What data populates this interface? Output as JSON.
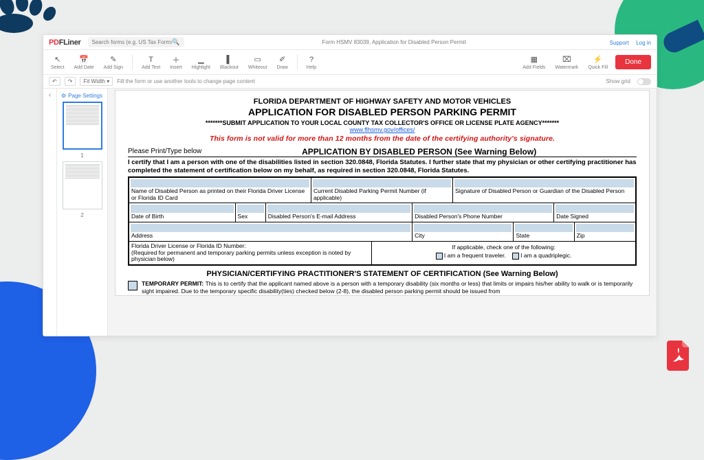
{
  "brand": {
    "pre": "P",
    "mid": "D",
    "post": "FLiner"
  },
  "search_placeholder": "Search forms (e.g. US Tax Forms...",
  "doc_title": "Form HSMV 83039, Application for Disabled Person Permit",
  "links": {
    "support": "Support",
    "login": "Log in"
  },
  "toolbar": [
    {
      "icon": "↖",
      "label": "Select"
    },
    {
      "icon": "📅",
      "label": "Add Date"
    },
    {
      "icon": "✎",
      "label": "Add Sign"
    },
    {
      "sep": true
    },
    {
      "icon": "T",
      "label": "Add Text"
    },
    {
      "icon": "＋",
      "label": "Insert"
    },
    {
      "icon": "▁",
      "label": "Highlight"
    },
    {
      "icon": "▌",
      "label": "Blackout"
    },
    {
      "icon": "▭",
      "label": "Whiteout"
    },
    {
      "icon": "✐",
      "label": "Draw"
    },
    {
      "sep": true
    },
    {
      "icon": "?",
      "label": "Help"
    }
  ],
  "toolbar_right": [
    {
      "icon": "▦",
      "label": "Add Fields"
    },
    {
      "icon": "⌧",
      "label": "Watermark"
    },
    {
      "icon": "⚡",
      "label": "Quick Fill"
    }
  ],
  "done_label": "Done",
  "subbar": {
    "fit": "Fit Width",
    "hint": "Fill the form or use another tools to change page content",
    "showgrid": "Show grid"
  },
  "thumbs_header": "Page Settings",
  "thumb_nums": [
    "1",
    "2"
  ],
  "page": {
    "dept": "FLORIDA DEPARTMENT OF HIGHWAY SAFETY AND MOTOR VEHICLES",
    "app_title": "APPLICATION FOR DISABLED PERSON PARKING PERMIT",
    "submit": "*******SUBMIT APPLICATION TO YOUR LOCAL COUNTY TAX COLLECTOR'S OFFICE OR LICENSE PLATE AGENCY*******",
    "url": "www.flhsmv.gov/offices/",
    "red": "This form is not valid for more than 12 months from the date of the certifying authority's signature.",
    "please": "Please Print/Type below",
    "section1": "APPLICATION BY DISABLED PERSON (See Warning Below)",
    "cert": "I certify that I am a person with one of the disabilities listed in section 320.0848, Florida Statutes.  I further state that my physician or other certifying practitioner has completed the statement of certification below on my behalf, as required in section 320.0848, Florida Statutes.",
    "fields": {
      "name": "Name of Disabled Person as printed on their Florida Driver License or Florida ID Card",
      "permitno": "Current Disabled Parking Permit Number (if applicable)",
      "sig": "Signature of Disabled Person or Guardian of the Disabled Person",
      "dob": "Date of Birth",
      "sex": "Sex",
      "email": "Disabled Person's E-mail Address",
      "phone": "Disabled Person's Phone Number",
      "datesigned": "Date Signed",
      "address": "Address",
      "city": "City",
      "state": "State",
      "zip": "Zip",
      "flid": "Florida Driver License or Florida ID Number:\n(Required for permanent and temporary parking permits unless exception is noted by physician below)",
      "checkhead": "If applicable, check one of the following:",
      "opt1": "I am a frequent traveler.",
      "opt2": "I am a quadriplegic."
    },
    "phys_head": "PHYSICIAN/CERTIFYING PRACTITIONER'S STATEMENT OF CERTIFICATION (See Warning Below)",
    "temp_label": "TEMPORARY PERMIT:",
    "temp_body": "This is to certify that the applicant named above is a person with a temporary disability (six months or less) that limits or impairs his/her ability to walk or is temporarily sight impaired.  Due to the temporary specific disability(ties) checked below (2-8), the disabled person parking permit should be issued from"
  }
}
